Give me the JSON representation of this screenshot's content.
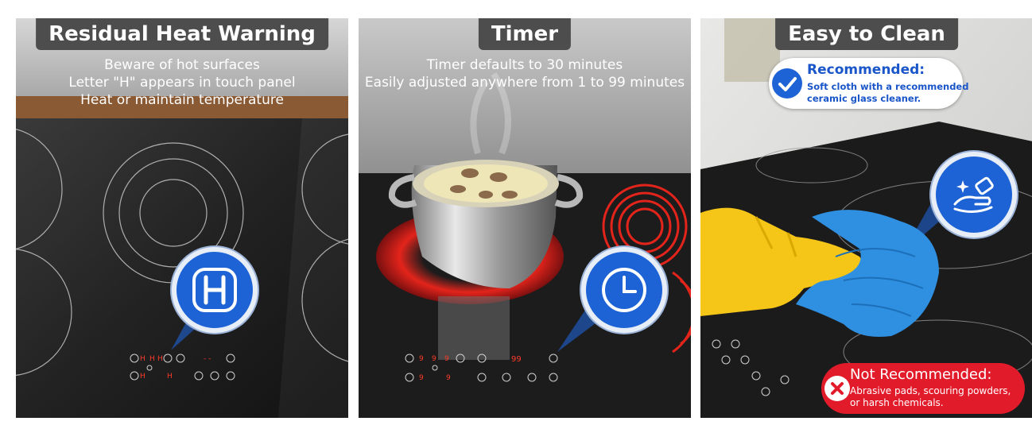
{
  "panels": [
    {
      "title": "Residual Heat Warning",
      "lines": [
        "Beware of hot surfaces",
        "Letter \"H\" appears in touch panel",
        "Heat or maintain temperature"
      ],
      "icon": "letter-h-icon"
    },
    {
      "title": "Timer",
      "lines": [
        "Timer defaults to 30 minutes",
        "Easily adjusted anywhere from 1 to 99 minutes"
      ],
      "icon": "clock-icon",
      "display": "99"
    },
    {
      "title": "Easy to Clean",
      "icon": "cleaning-hand-icon",
      "recommended": {
        "title": "Recommended:",
        "lines": [
          "Soft cloth with a recommended",
          "ceramic glass cleaner."
        ],
        "icon": "check-icon"
      },
      "not_recommended": {
        "title": "Not Recommended:",
        "lines": [
          "Abrasive pads, scouring powders,",
          "or harsh chemicals."
        ],
        "icon": "x-icon"
      }
    }
  ],
  "colors": {
    "tab_bg": "#4d4d4d",
    "accent_blue": "#1e63d6",
    "alert_red": "#e21b2b",
    "glass": "#1f1f1f",
    "glove_yellow": "#f5c518",
    "cloth_blue": "#2f8fe0",
    "hot_red": "#e3241b"
  }
}
